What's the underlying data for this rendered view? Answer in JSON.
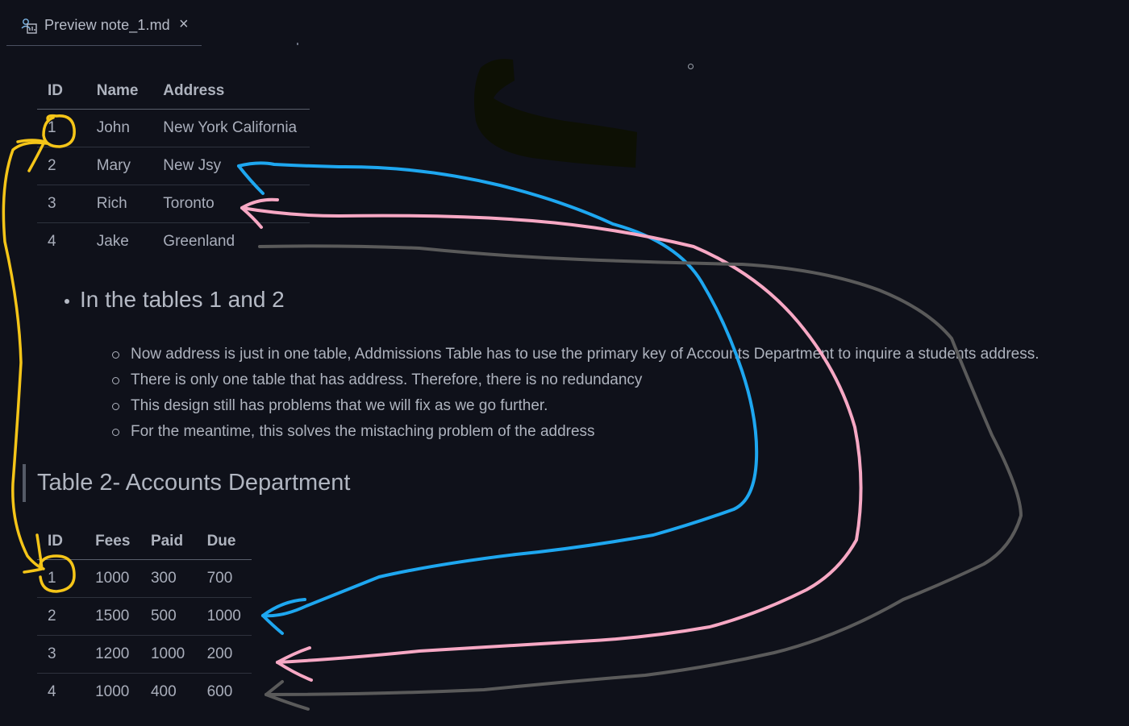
{
  "tab": {
    "label": "Preview note_1.md",
    "close": "×",
    "icon": "preview-icon"
  },
  "table1": {
    "headers": [
      "ID",
      "Name",
      "Address"
    ],
    "rows": [
      [
        "1",
        "John",
        "New York California"
      ],
      [
        "2",
        "Mary",
        "New Jsy"
      ],
      [
        "3",
        "Rich",
        "Toronto"
      ],
      [
        "4",
        "Jake",
        "Greenland"
      ]
    ]
  },
  "bullet": {
    "main": "In the tables 1 and 2",
    "subitems": [
      "Now address is just in one table, Addmissions Table has to use the primary key of Accounts Department to inquire a students address.",
      "There is only one table that has address. Therefore, there is no redundancy",
      "This design still has problems that we will fix as we go further.",
      "For the meantime, this solves the mistaching problem of the address"
    ]
  },
  "heading": "Table 2- Accounts Department",
  "table2": {
    "headers": [
      "ID",
      "Fees",
      "Paid",
      "Due"
    ],
    "rows": [
      [
        "1",
        "1000",
        "300",
        "700"
      ],
      [
        "2",
        "1500",
        "500",
        "1000"
      ],
      [
        "3",
        "1200",
        "1000",
        "200"
      ],
      [
        "4",
        "1000",
        "400",
        "600"
      ]
    ]
  },
  "colors": {
    "background": "#0f111a",
    "annotation_yellow": "#f5c518",
    "annotation_blue": "#1ea7f0",
    "annotation_pink": "#f7a8c4",
    "annotation_gray": "#5a5a5a",
    "annotation_blob": "#0d1004"
  }
}
